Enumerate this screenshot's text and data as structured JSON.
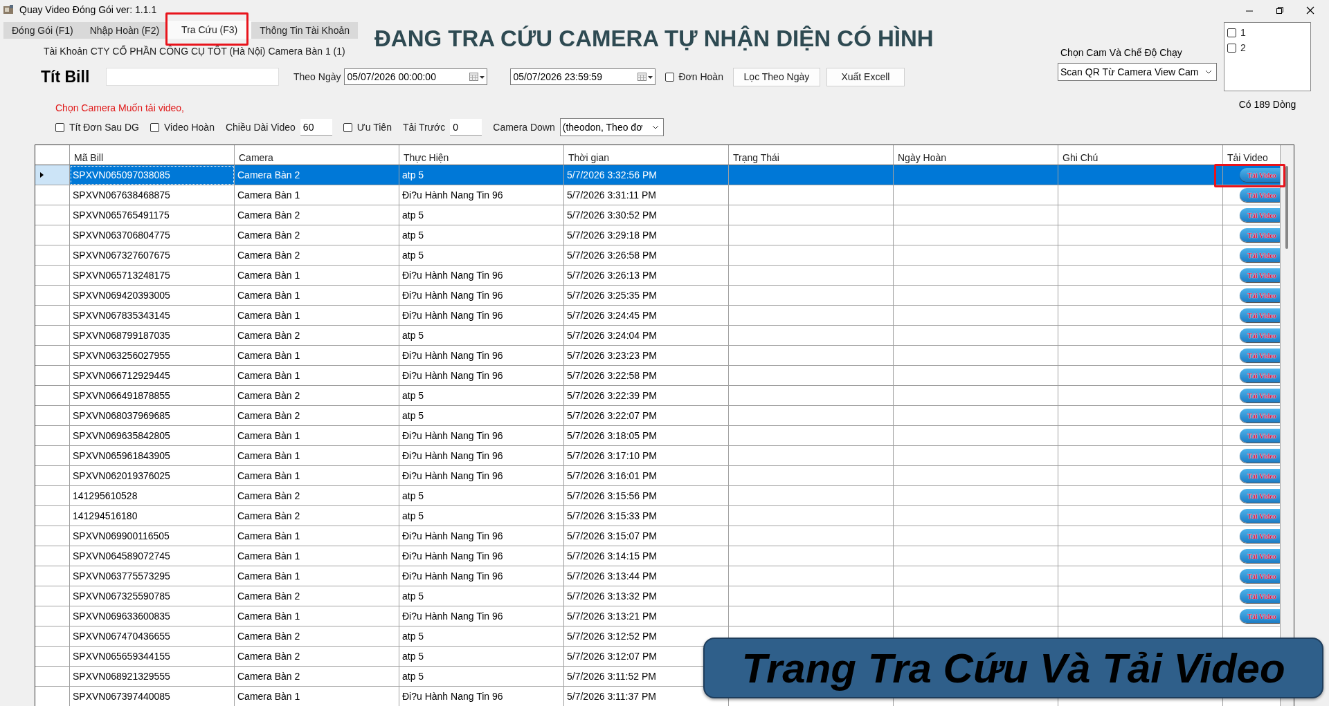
{
  "window": {
    "title": "Quay Video Đóng Gói ver: 1.1.1"
  },
  "tabs": [
    {
      "label": "Đóng Gói (F1)",
      "selected": false
    },
    {
      "label": "Nhập Hoàn (F2)",
      "selected": false
    },
    {
      "label": "Tra Cứu (F3)",
      "selected": true
    },
    {
      "label": "Thông Tin Tài Khoản",
      "selected": false
    }
  ],
  "heading": "ĐANG TRA CỨU CAMERA TỰ NHẬN DIỆN CÓ HÌNH",
  "account_line": "Tài Khoản CTY CỔ PHẦN CÔNG CỤ TỐT (Hà Nội) Camera Bàn 1 (1)",
  "scan": {
    "label": "Tít Bill"
  },
  "date_filter": {
    "label": "Theo Ngày",
    "from": "05/07/2026 00:00:00",
    "to": "05/07/2026 23:59:59"
  },
  "return_only": {
    "label": "Đơn Hoàn",
    "checked": false
  },
  "buttons": [
    "Lọc Theo Ngày",
    "Xuất Excell"
  ],
  "camera_mode": {
    "label": "Chọn Cam Và Chế Độ Chạy",
    "value": "Scan QR Từ Camera View Cam"
  },
  "camera_list": [
    {
      "label": "1",
      "checked": false
    },
    {
      "label": "2",
      "checked": false
    }
  ],
  "row_count": "Có 189 Dòng",
  "download_hint": "Chọn Camera Muốn tải video,",
  "options": [
    {
      "kind": "checkbox",
      "label": "Tít Đơn Sau DG",
      "checked": false
    },
    {
      "kind": "checkbox",
      "label": "Video Hoàn",
      "checked": false
    },
    {
      "kind": "number",
      "label": "Chiều Dài Video",
      "value": "60"
    },
    {
      "kind": "checkbox",
      "label": "Ưu Tiên",
      "checked": false
    },
    {
      "kind": "number",
      "label": "Tải Trước",
      "value": "0"
    },
    {
      "kind": "select",
      "label": "Camera Down",
      "value": "(theodon, Theo đơ"
    }
  ],
  "table": {
    "columns": [
      "Mã Bill",
      "Camera",
      "Thực Hiện",
      "Thời gian",
      "Trạng Thái",
      "Ngày Hoàn",
      "Ghi Chú",
      "Tải Video"
    ],
    "rows": [
      {
        "cells": [
          "SPXVN065097038085",
          "Camera Bàn 2",
          "atp 5",
          "5/7/2026 3:32:56 PM"
        ],
        "selected": true,
        "download": "Tải Video"
      },
      {
        "cells": [
          "SPXVN067638468875",
          "Camera Bàn 1",
          "Đi?u Hành Nang Tin 96",
          "5/7/2026 3:31:11 PM"
        ],
        "selected": false,
        "download": "Tải Video"
      },
      {
        "cells": [
          "SPXVN065765491175",
          "Camera Bàn 2",
          "atp 5",
          "5/7/2026 3:30:52 PM"
        ],
        "selected": false,
        "download": "Tải Video"
      },
      {
        "cells": [
          "SPXVN063706804775",
          "Camera Bàn 2",
          "atp 5",
          "5/7/2026 3:29:18 PM"
        ],
        "selected": false,
        "download": "Tải Video"
      },
      {
        "cells": [
          "SPXVN067327607675",
          "Camera Bàn 2",
          "atp 5",
          "5/7/2026 3:26:58 PM"
        ],
        "selected": false,
        "download": "Tải Video"
      },
      {
        "cells": [
          "SPXVN065713248175",
          "Camera Bàn 1",
          "Đi?u Hành Nang Tin 96",
          "5/7/2026 3:26:13 PM"
        ],
        "selected": false,
        "download": "Tải Video"
      },
      {
        "cells": [
          "SPXVN069420393005",
          "Camera Bàn 1",
          "Đi?u Hành Nang Tin 96",
          "5/7/2026 3:25:35 PM"
        ],
        "selected": false,
        "download": "Tải Video"
      },
      {
        "cells": [
          "SPXVN067835343145",
          "Camera Bàn 1",
          "Đi?u Hành Nang Tin 96",
          "5/7/2026 3:24:45 PM"
        ],
        "selected": false,
        "download": "Tải Video"
      },
      {
        "cells": [
          "SPXVN068799187035",
          "Camera Bàn 2",
          "atp 5",
          "5/7/2026 3:24:04 PM"
        ],
        "selected": false,
        "download": "Tải Video"
      },
      {
        "cells": [
          "SPXVN063256027955",
          "Camera Bàn 1",
          "Đi?u Hành Nang Tin 96",
          "5/7/2026 3:23:23 PM"
        ],
        "selected": false,
        "download": "Tải Video"
      },
      {
        "cells": [
          "SPXVN066712929445",
          "Camera Bàn 1",
          "Đi?u Hành Nang Tin 96",
          "5/7/2026 3:22:58 PM"
        ],
        "selected": false,
        "download": "Tải Video"
      },
      {
        "cells": [
          "SPXVN066491878855",
          "Camera Bàn 2",
          "atp 5",
          "5/7/2026 3:22:39 PM"
        ],
        "selected": false,
        "download": "Tải Video"
      },
      {
        "cells": [
          "SPXVN068037969685",
          "Camera Bàn 2",
          "atp 5",
          "5/7/2026 3:22:07 PM"
        ],
        "selected": false,
        "download": "Tải Video"
      },
      {
        "cells": [
          "SPXVN069635842805",
          "Camera Bàn 1",
          "Đi?u Hành Nang Tin 96",
          "5/7/2026 3:18:05 PM"
        ],
        "selected": false,
        "download": "Tải Video"
      },
      {
        "cells": [
          "SPXVN065961843905",
          "Camera Bàn 1",
          "Đi?u Hành Nang Tin 96",
          "5/7/2026 3:17:10 PM"
        ],
        "selected": false,
        "download": "Tải Video"
      },
      {
        "cells": [
          "SPXVN062019376025",
          "Camera Bàn 1",
          "Đi?u Hành Nang Tin 96",
          "5/7/2026 3:16:01 PM"
        ],
        "selected": false,
        "download": "Tải Video"
      },
      {
        "cells": [
          "141295610528",
          "Camera Bàn 2",
          "atp 5",
          "5/7/2026 3:15:56 PM"
        ],
        "selected": false,
        "download": "Tải Video"
      },
      {
        "cells": [
          "141294516180",
          "Camera Bàn 2",
          "atp 5",
          "5/7/2026 3:15:33 PM"
        ],
        "selected": false,
        "download": "Tải Video"
      },
      {
        "cells": [
          "SPXVN069900116505",
          "Camera Bàn 1",
          "Đi?u Hành Nang Tin 96",
          "5/7/2026 3:15:07 PM"
        ],
        "selected": false,
        "download": "Tải Video"
      },
      {
        "cells": [
          "SPXVN064589072745",
          "Camera Bàn 1",
          "Đi?u Hành Nang Tin 96",
          "5/7/2026 3:14:15 PM"
        ],
        "selected": false,
        "download": "Tải Video"
      },
      {
        "cells": [
          "SPXVN063775573295",
          "Camera Bàn 1",
          "Đi?u Hành Nang Tin 96",
          "5/7/2026 3:13:44 PM"
        ],
        "selected": false,
        "download": "Tải Video"
      },
      {
        "cells": [
          "SPXVN067325590785",
          "Camera Bàn 2",
          "atp 5",
          "5/7/2026 3:13:32 PM"
        ],
        "selected": false,
        "download": "Tải Video"
      },
      {
        "cells": [
          "SPXVN069633600835",
          "Camera Bàn 1",
          "Đi?u Hành Nang Tin 96",
          "5/7/2026 3:13:21 PM"
        ],
        "selected": false,
        "download": "Tải Video"
      },
      {
        "cells": [
          "SPXVN067470436655",
          "Camera Bàn 2",
          "atp 5",
          "5/7/2026 3:12:52 PM"
        ],
        "selected": false
      },
      {
        "cells": [
          "SPXVN065659344155",
          "Camera Bàn 2",
          "atp 5",
          "5/7/2026 3:12:07 PM"
        ],
        "selected": false
      },
      {
        "cells": [
          "SPXVN068921329555",
          "Camera Bàn 2",
          "atp 5",
          "5/7/2026 3:11:52 PM"
        ],
        "selected": false
      },
      {
        "cells": [
          "SPXVN067397440085",
          "Camera Bàn 1",
          "Đi?u Hành Nang Tin 96",
          "5/7/2026 3:11:37 PM"
        ],
        "selected": false
      }
    ]
  },
  "caption": "Trang Tra Cứu Và Tải Video"
}
